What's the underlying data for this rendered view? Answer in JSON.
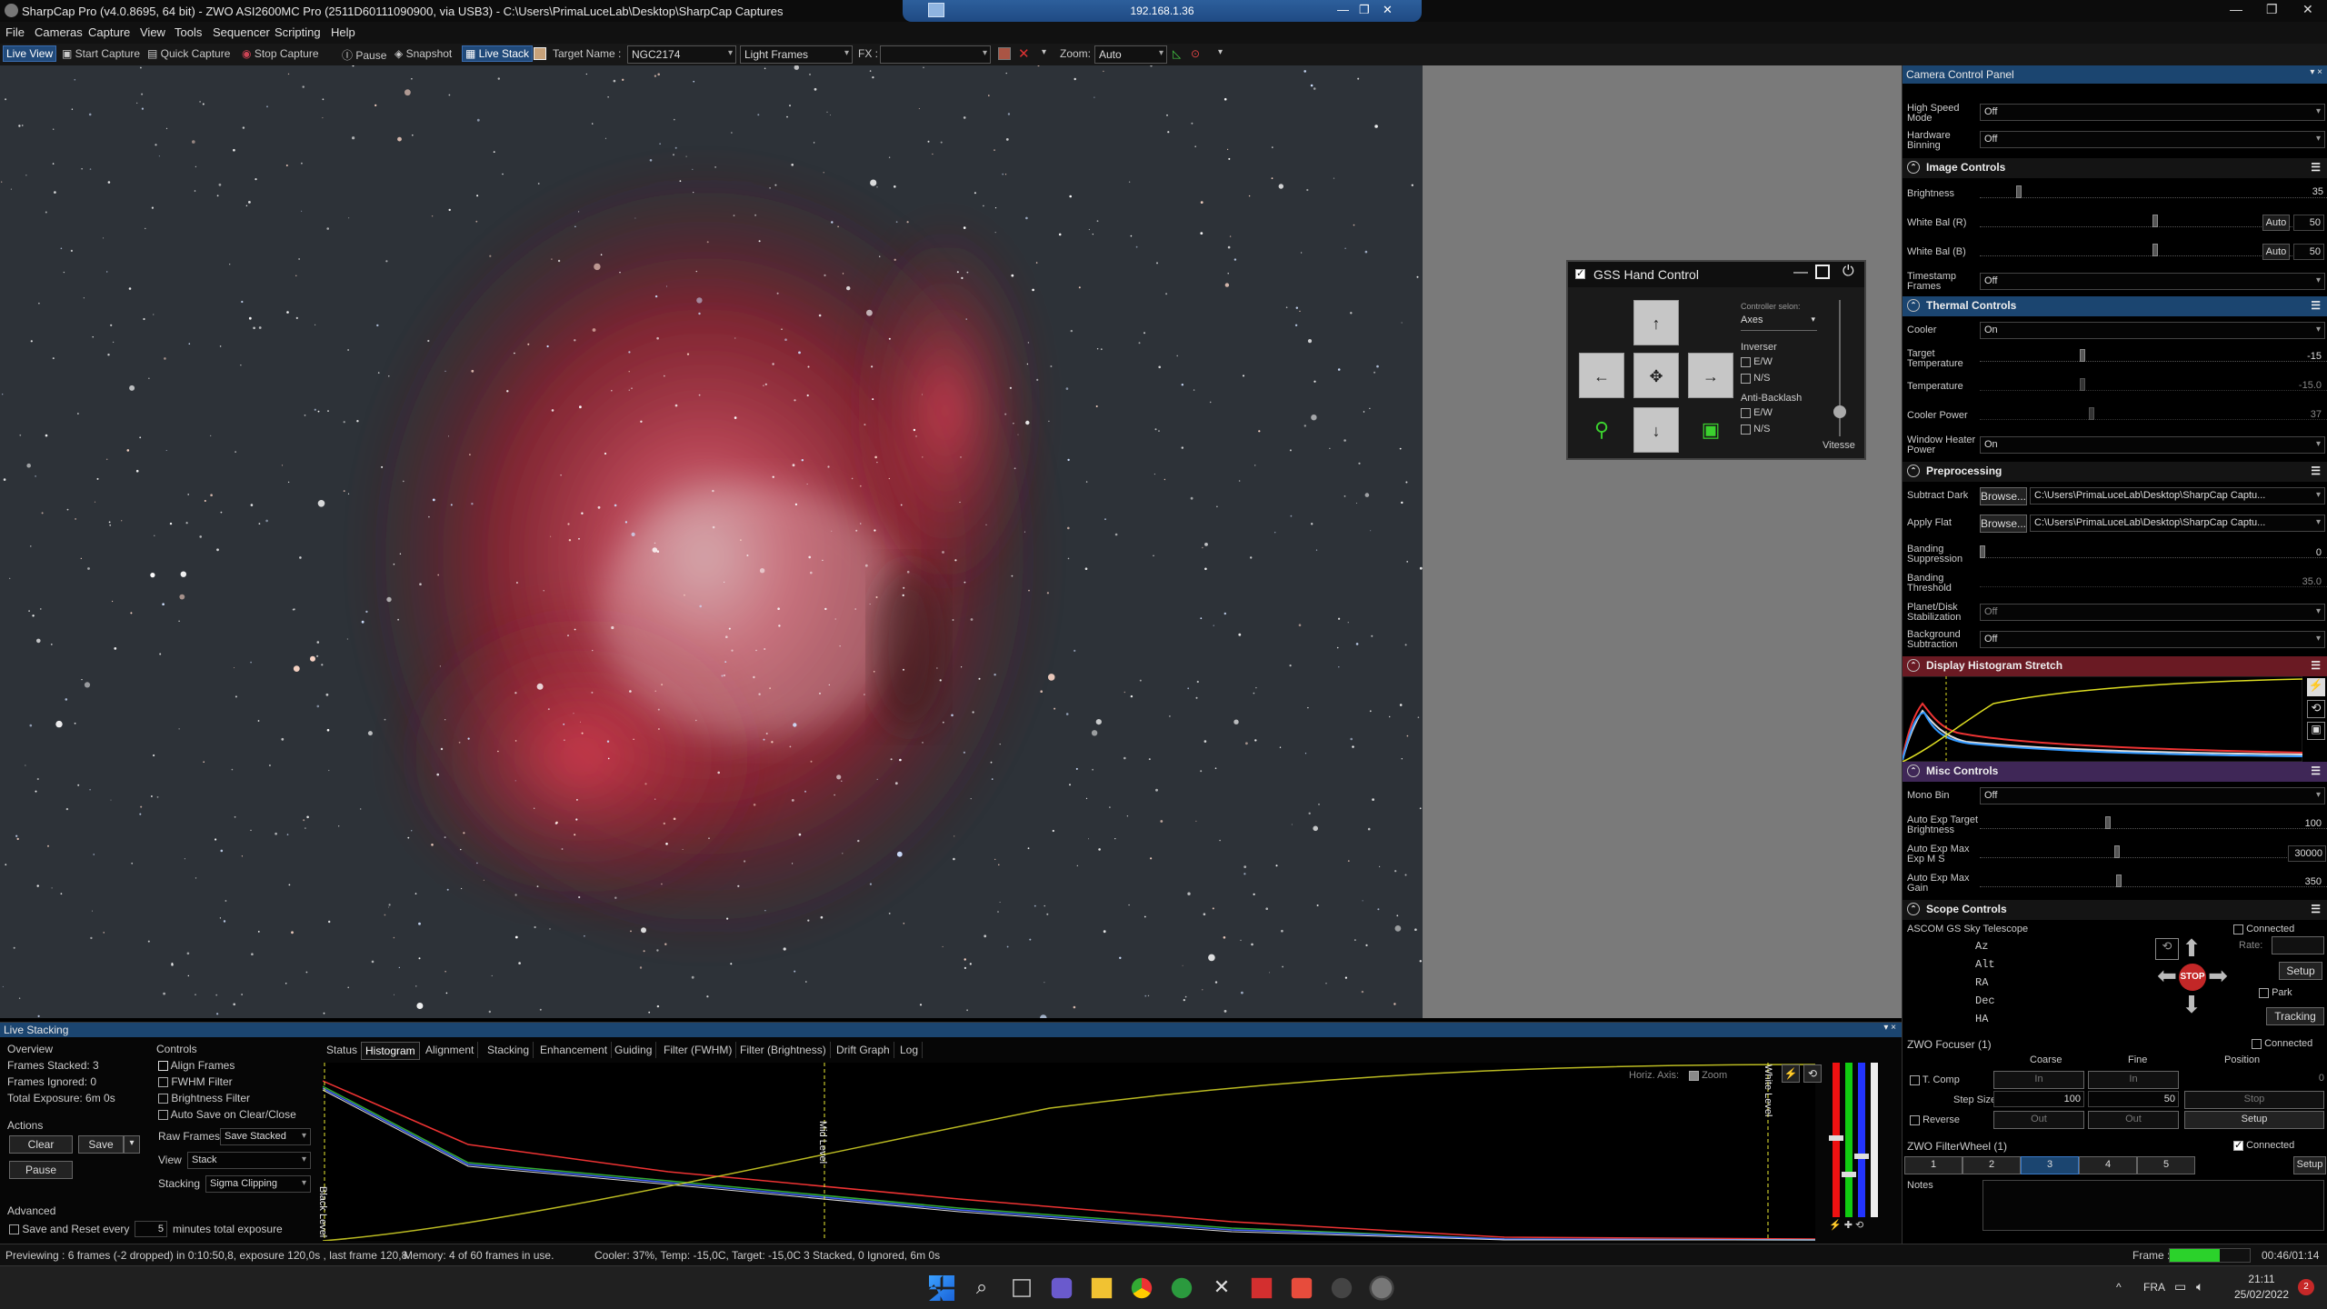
{
  "window": {
    "title": "SharpCap Pro (v4.0.8695, 64 bit) - ZWO ASI2600MC Pro (2511D60111090900, via USB3) - C:\\Users\\PrimaLuceLab\\Desktop\\SharpCap Captures",
    "remote_ip": "192.168.1.36"
  },
  "menu": [
    "File",
    "Cameras",
    "Capture",
    "View",
    "Tools",
    "Sequencer",
    "Scripting",
    "Help"
  ],
  "toolbar": {
    "live_view": "Live View",
    "start_capture": "Start Capture",
    "quick_capture": "Quick Capture",
    "stop_capture": "Stop Capture",
    "pause": "Pause",
    "snapshot": "Snapshot",
    "live_stack": "Live Stack",
    "target_label": "Target Name :",
    "target_value": "NGC2174",
    "frame_type": "Light Frames",
    "fx_label": "FX :",
    "zoom_label": "Zoom:",
    "zoom_value": "Auto"
  },
  "gss": {
    "title": "GSS Hand Control",
    "controller_label": "Controller selon:",
    "controller_value": "Axes",
    "inverser": "Inverser",
    "ew": "E/W",
    "ns": "N/S",
    "anti_backlash": "Anti-Backlash",
    "vitesse": "Vitesse",
    "up": "↑",
    "down": "↓",
    "left": "←",
    "right": "→",
    "center": "✥"
  },
  "camera_panel": {
    "title": "Camera Control Panel",
    "top_rows": [
      {
        "label": "High Speed Mode",
        "value": "Off"
      },
      {
        "label": "Hardware Binning",
        "value": "Off"
      }
    ],
    "image_controls": {
      "title": "Image Controls",
      "brightness": {
        "label": "Brightness",
        "value": "35"
      },
      "wb_r": {
        "label": "White Bal (R)",
        "auto": "Auto",
        "value": "50"
      },
      "wb_b": {
        "label": "White Bal (B)",
        "auto": "Auto",
        "value": "50"
      },
      "timestamp": {
        "label": "Timestamp Frames",
        "value": "Off"
      }
    },
    "thermal": {
      "title": "Thermal Controls",
      "cooler": {
        "label": "Cooler",
        "value": "On"
      },
      "target_temp": {
        "label": "Target Temperature",
        "value": "-15"
      },
      "temperature": {
        "label": "Temperature",
        "value": "-15.0"
      },
      "cooler_power": {
        "label": "Cooler Power",
        "value": "37"
      },
      "window_heater": {
        "label": "Window Heater Power",
        "value": "On"
      }
    },
    "preprocessing": {
      "title": "Preprocessing",
      "subtract_dark": {
        "label": "Subtract Dark",
        "browse": "Browse...",
        "path": "C:\\Users\\PrimaLuceLab\\Desktop\\SharpCap Captu..."
      },
      "apply_flat": {
        "label": "Apply Flat",
        "browse": "Browse...",
        "path": "C:\\Users\\PrimaLuceLab\\Desktop\\SharpCap Captu..."
      },
      "banding_supp": {
        "label": "Banding Suppression",
        "value": "0"
      },
      "banding_thr": {
        "label": "Banding Threshold",
        "value": "35.0"
      },
      "planet_disk": {
        "label": "Planet/Disk Stabilization",
        "value": "Off"
      },
      "background_sub": {
        "label": "Background Subtraction",
        "value": "Off"
      }
    },
    "histogram_stretch": {
      "title": "Display Histogram Stretch"
    },
    "misc": {
      "title": "Misc Controls",
      "mono_bin": {
        "label": "Mono Bin",
        "value": "Off"
      },
      "ae_target": {
        "label": "Auto Exp Target Brightness",
        "value": "100"
      },
      "ae_max_exp": {
        "label": "Auto Exp Max Exp M S",
        "value": "30000"
      },
      "ae_max_gain": {
        "label": "Auto Exp Max Gain",
        "value": "350"
      }
    },
    "scope": {
      "title": "Scope Controls",
      "name": "ASCOM GS Sky Telescope",
      "connected": "Connected",
      "az": "Az",
      "alt": "Alt",
      "ra": "RA",
      "dec": "Dec",
      "ha": "HA",
      "rate": "Rate:",
      "setup": "Setup",
      "park": "Park",
      "tracking": "Tracking",
      "stop": "STOP"
    },
    "focuser": {
      "title": "ZWO Focuser (1)",
      "connected": "Connected",
      "coarse": "Coarse",
      "fine": "Fine",
      "position": "Position",
      "tcomp": "T. Comp",
      "in": "In",
      "pos_value": "0",
      "step_size": "Step Size",
      "coarse_step": "100",
      "fine_step": "50",
      "stop": "Stop",
      "reverse": "Reverse",
      "out": "Out",
      "setup": "Setup"
    },
    "filterwheel": {
      "title": "ZWO FilterWheel (1)",
      "connected": "Connected",
      "slots": [
        "1",
        "2",
        "3",
        "4",
        "5"
      ],
      "setup": "Setup"
    },
    "notes": "Notes"
  },
  "live_stacking": {
    "title": "Live Stacking",
    "overview": "Overview",
    "frames_stacked": "Frames Stacked: 3",
    "frames_ignored": "Frames Ignored: 0",
    "total_exposure": "Total Exposure:  6m 0s",
    "actions": "Actions",
    "clear": "Clear",
    "save": "Save",
    "pause": "Pause",
    "advanced": "Advanced",
    "save_reset": "Save and Reset every",
    "minutes_value": "5",
    "minutes_label": "minutes total exposure",
    "controls": "Controls",
    "align_frames": "Align Frames",
    "fwhm_filter": "FWHM Filter",
    "brightness_filter": "Brightness Filter",
    "auto_save": "Auto Save on Clear/Close",
    "raw_frames_label": "Raw Frames",
    "raw_frames_value": "Save Stacked",
    "view_label": "View",
    "view_value": "Stack",
    "stacking_label": "Stacking",
    "stacking_value": "Sigma Clipping",
    "tabs": [
      "Status",
      "Histogram",
      "Alignment",
      "Stacking",
      "Enhancement",
      "Guiding",
      "Filter (FWHM)",
      "Filter (Brightness)",
      "Drift Graph",
      "Log"
    ],
    "horiz_axis": "Horiz. Axis:",
    "zoom": "Zoom",
    "black_level": "Black Level",
    "mid_level": "Mid Level",
    "white_level": "White Level"
  },
  "status_bar": {
    "previewing": "Previewing : 6 frames (-2 dropped) in 0:10:50,8, exposure 120,0s , last frame 120,8",
    "memory": "Memory: 4 of 60 frames in use.",
    "cooler": "Cooler: 37%, Temp: -15,0C, Target: -15,0C",
    "stacked": "3 Stacked, 0 Ignored, 6m 0s",
    "frame_label": "Frame :",
    "elapsed": "00:46/01:14"
  },
  "taskbar": {
    "lang": "FRA",
    "time": "21:11",
    "date": "25/02/2022",
    "badge": "2"
  },
  "colors": {
    "panel_header": "#1b4570",
    "red": "#d0352a",
    "green": "#2ad32a",
    "accent_blue": "#2f6fb5"
  }
}
